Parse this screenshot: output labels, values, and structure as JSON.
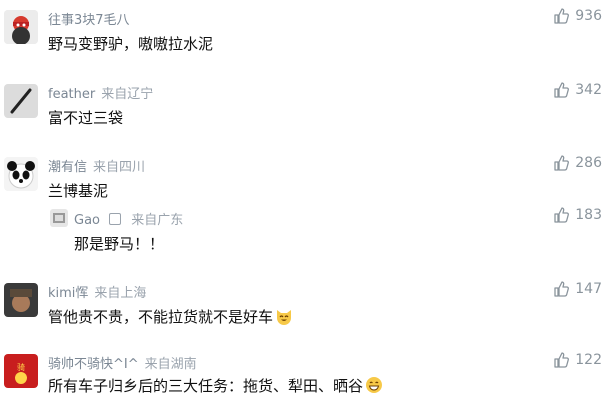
{
  "comments": [
    {
      "user": "往事3块7毛八",
      "location": "",
      "text": "野马变野驴，嗷嗷拉水泥",
      "likes": "936"
    },
    {
      "user": "feather",
      "location": "来自辽宁",
      "text": "富不过三袋",
      "likes": "342"
    },
    {
      "user": "潮有信",
      "location": "来自四川",
      "text": "兰博基泥",
      "likes": "286",
      "reply": {
        "user": "Gao",
        "location": "来自广东",
        "text": "那是野马！！",
        "likes": "183"
      }
    },
    {
      "user": "kimi恽",
      "location": "来自上海",
      "text": "管他贵不贵，不能拉货就不是好车",
      "likes": "147"
    },
    {
      "user": "骑帅不骑快^I^",
      "location": "来自湖南",
      "text": "所有车子归乡后的三大任务：拖货、犁田、晒谷",
      "likes": "122"
    }
  ],
  "icons": {
    "like": "thumbs-up-icon",
    "emoji_cat": "laughing-cat-emoji",
    "emoji_grin": "grinning-face-emoji"
  },
  "colors": {
    "meta": "#7b8794",
    "location": "#9aa3ad",
    "like": "#8a949c"
  }
}
